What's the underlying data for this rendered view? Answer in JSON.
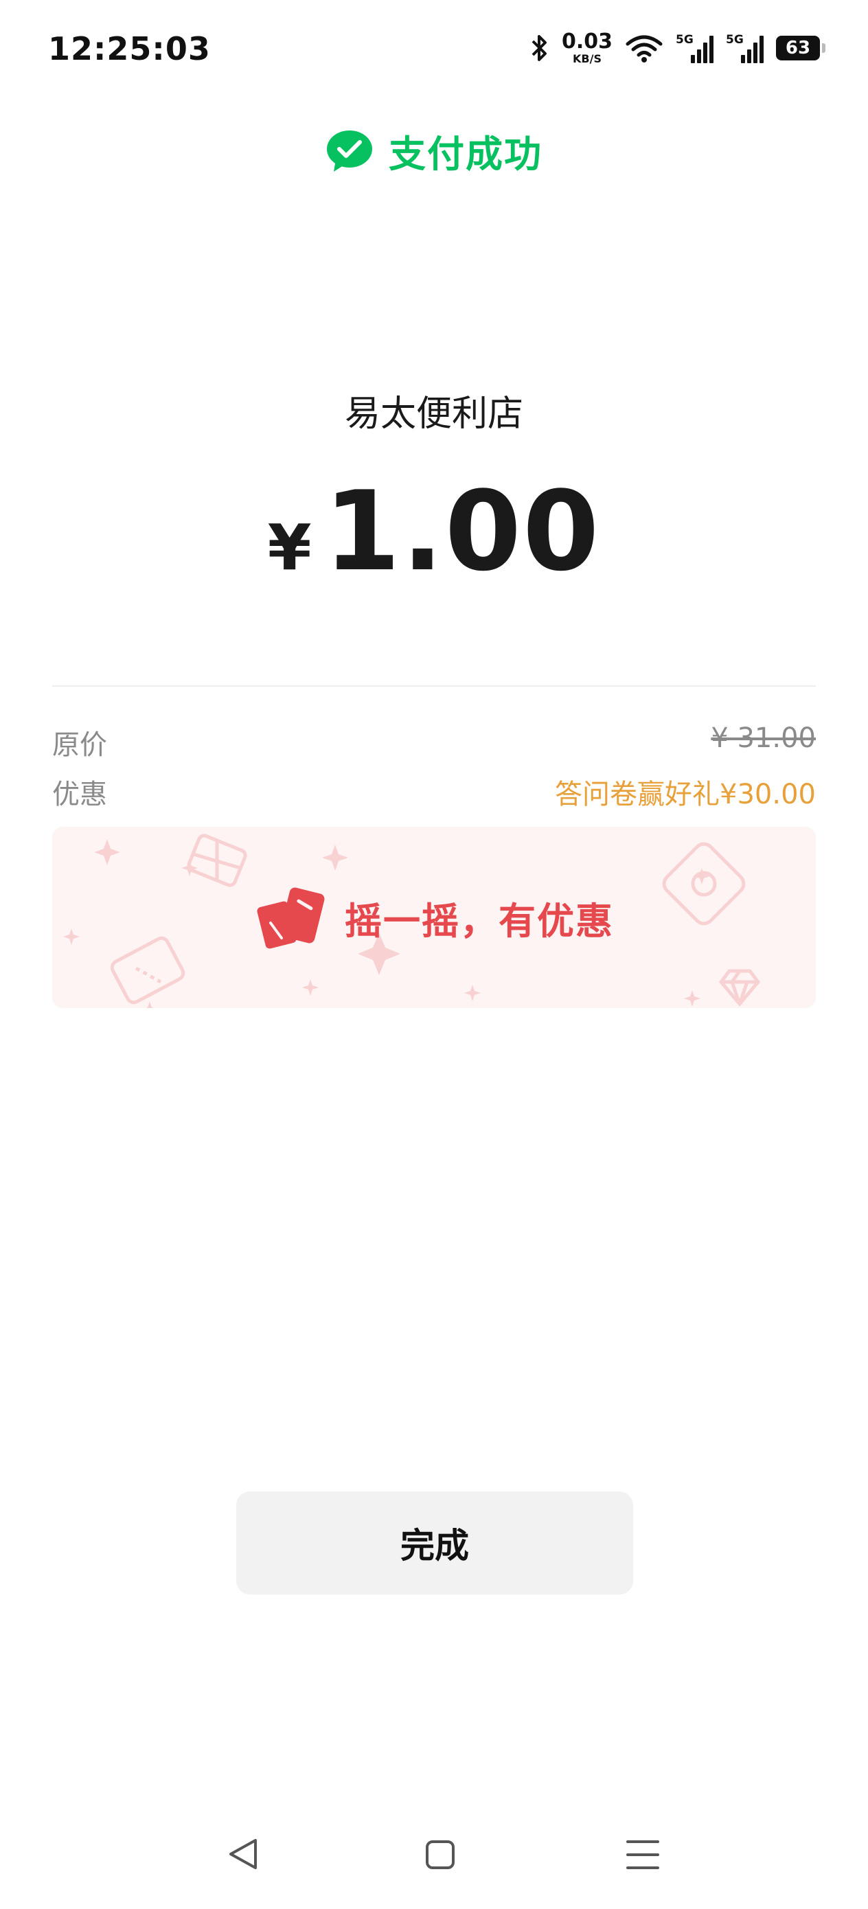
{
  "status_bar": {
    "time": "12:25:03",
    "net_speed_value": "0.03",
    "net_speed_unit": "KB/S",
    "sim1_tag": "5G",
    "sim2_tag": "5G",
    "battery": "63"
  },
  "header": {
    "title": "支付成功",
    "accent_color": "#07c160"
  },
  "merchant": {
    "name": "易太便利店"
  },
  "amount": {
    "currency": "¥",
    "value": "1.00"
  },
  "details": {
    "original_label": "原价",
    "original_value": "¥ 31.00",
    "discount_label": "优惠",
    "discount_value": "答问卷赢好礼¥30.00"
  },
  "banner": {
    "text": "摇一摇，有优惠"
  },
  "actions": {
    "done_label": "完成"
  },
  "nav": {
    "icons": [
      "back-icon",
      "home-icon",
      "menu-icon"
    ]
  }
}
